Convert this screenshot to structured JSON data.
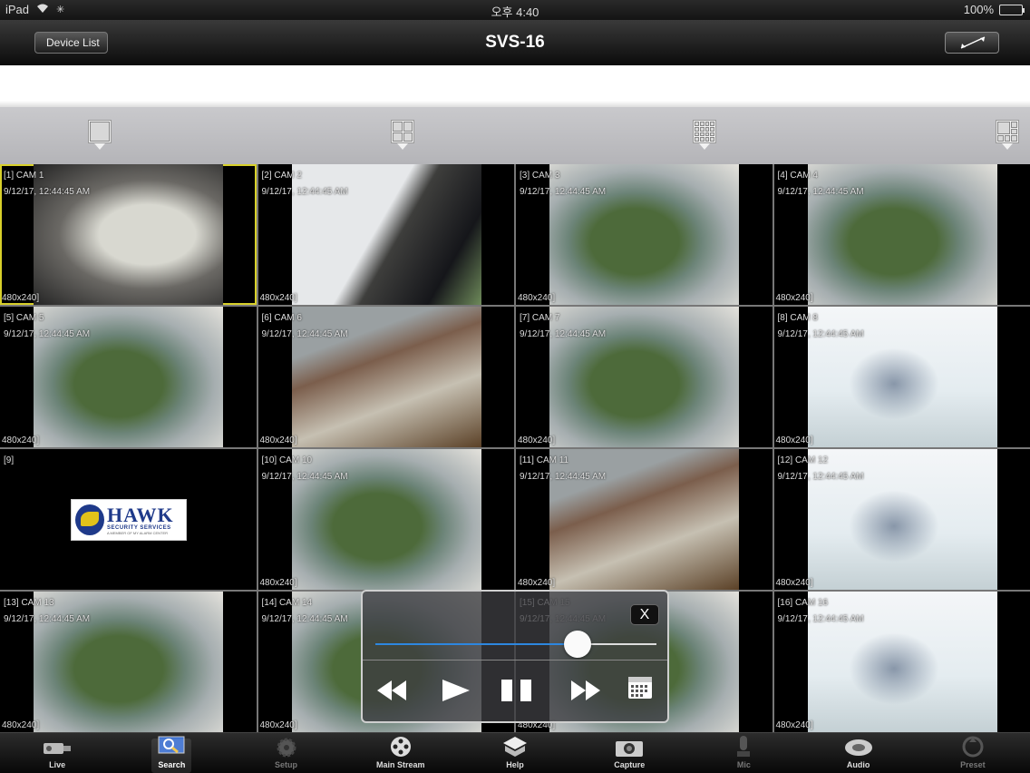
{
  "status": {
    "device": "iPad",
    "time": "오후 4:40",
    "battery": "100%"
  },
  "nav": {
    "back_label": "Device List",
    "title": "SVS-16"
  },
  "layouts": [
    "1x1",
    "2x2",
    "4x4",
    "custom"
  ],
  "cameras": [
    {
      "label": "[1] CAM 1",
      "time": "9/12/17, 12:44:45 AM",
      "res": "480x240]",
      "scene": "a"
    },
    {
      "label": "[2] CAM 2",
      "time": "9/12/17, 12:44:45 AM",
      "res": "480x240]",
      "scene": "b"
    },
    {
      "label": "[3] CAM 3",
      "time": "9/12/17, 12:44:45 AM",
      "res": "480x240]",
      "scene": "c"
    },
    {
      "label": "[4] CAM 4",
      "time": "9/12/17, 12:44:45 AM",
      "res": "480x240]",
      "scene": "c"
    },
    {
      "label": "[5] CAM 5",
      "time": "9/12/17, 12:44:45 AM",
      "res": "480x240]",
      "scene": "c"
    },
    {
      "label": "[6] CAM 6",
      "time": "9/12/17, 12:44:45 AM",
      "res": "480x240]",
      "scene": "d"
    },
    {
      "label": "[7] CAM 7",
      "time": "9/12/17, 12:44:45 AM",
      "res": "480x240]",
      "scene": "c"
    },
    {
      "label": "[8] CAM 8",
      "time": "9/12/17, 12:44:45 AM",
      "res": "480x240]",
      "scene": "e"
    },
    {
      "label": "[9]",
      "time": "",
      "res": "",
      "scene": "logo"
    },
    {
      "label": "[10] CAM 10",
      "time": "9/12/17, 12:44:45 AM",
      "res": "480x240]",
      "scene": "c"
    },
    {
      "label": "[11] CAM 11",
      "time": "9/12/17, 12:44:45 AM",
      "res": "480x240]",
      "scene": "d"
    },
    {
      "label": "[12] CAM 12",
      "time": "9/12/17, 12:44:45 AM",
      "res": "480x240]",
      "scene": "e"
    },
    {
      "label": "[13] CAM 13",
      "time": "9/12/17, 12:44:45 AM",
      "res": "480x240]",
      "scene": "c"
    },
    {
      "label": "[14] CAM 14",
      "time": "9/12/17, 12:44:45 AM",
      "res": "480x240]",
      "scene": "c"
    },
    {
      "label": "[15] CAM 15",
      "time": "9/12/17, 12:44:45 AM",
      "res": "480x240]",
      "scene": "c"
    },
    {
      "label": "[16] CAM 16",
      "time": "9/12/17, 12:44:45 AM",
      "res": "480x240]",
      "scene": "e"
    }
  ],
  "logo": {
    "name": "HAWK",
    "subtitle": "SECURITY SERVICES",
    "tagline": "A MEMBER OF MY ALARM CENTER"
  },
  "playback": {
    "close_label": "X",
    "position_fraction": 0.72
  },
  "tabs": [
    {
      "label": "Live",
      "icon": "camera-icon",
      "state": "normal"
    },
    {
      "label": "Search",
      "icon": "search-monitor-icon",
      "state": "active"
    },
    {
      "label": "Setup",
      "icon": "gear-icon",
      "state": "dim"
    },
    {
      "label": "Main Stream",
      "icon": "film-reel-icon",
      "state": "normal"
    },
    {
      "label": "Help",
      "icon": "help-icon",
      "state": "normal"
    },
    {
      "label": "Capture",
      "icon": "capture-camera-icon",
      "state": "normal"
    },
    {
      "label": "Mic",
      "icon": "mic-icon",
      "state": "dim"
    },
    {
      "label": "Audio",
      "icon": "speaker-icon",
      "state": "normal"
    },
    {
      "label": "Preset",
      "icon": "preset-icon",
      "state": "dim"
    }
  ],
  "colors": {
    "selection": "#d8d02a",
    "slider_fill": "#2d87e0"
  }
}
